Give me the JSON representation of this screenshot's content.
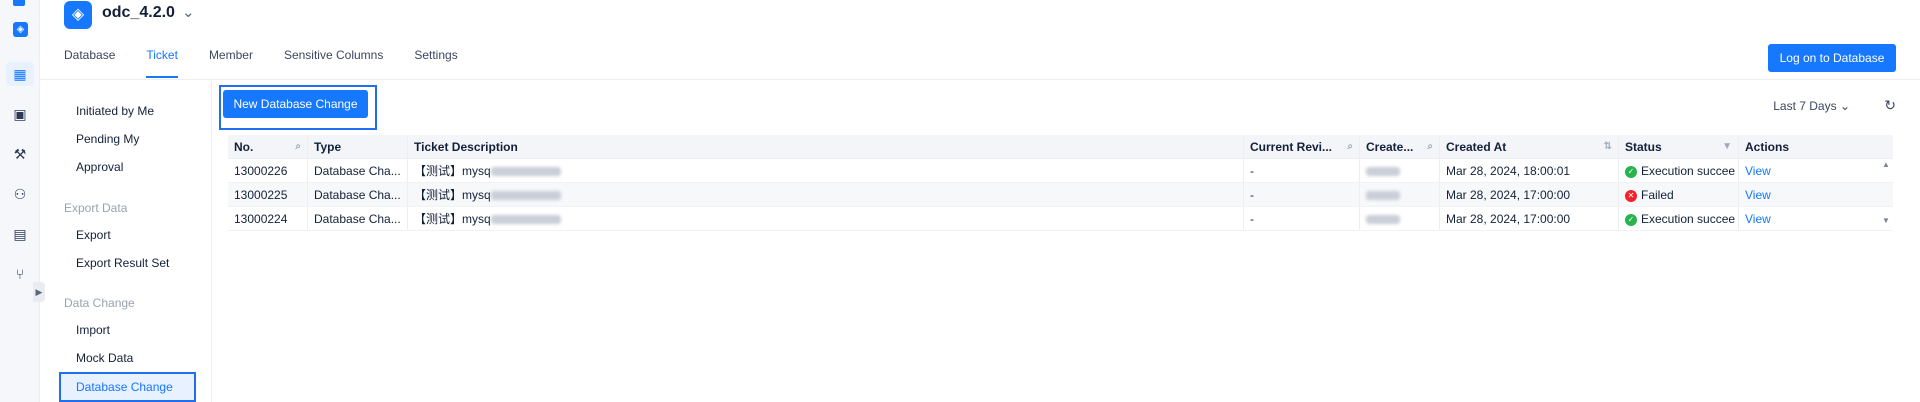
{
  "project": {
    "name": "odc_4.2.0"
  },
  "tabs": [
    {
      "label": "Database"
    },
    {
      "label": "Ticket"
    },
    {
      "label": "Member"
    },
    {
      "label": "Sensitive Columns"
    },
    {
      "label": "Settings"
    }
  ],
  "header": {
    "logon_label": "Log on to Database"
  },
  "sidebar": {
    "initiated": "Initiated by Me",
    "pending_1": "Pending My",
    "pending_2": "Approval",
    "export_group": "Export Data",
    "export": "Export",
    "export_result": "Export Result Set",
    "change_group": "Data Change",
    "import": "Import",
    "mock": "Mock Data",
    "db_change": "Database Change"
  },
  "toolbar": {
    "new_label": "New Database Change",
    "range_label": "Last 7 Days"
  },
  "table": {
    "headers": [
      "No.",
      "Type",
      "Ticket Description",
      "Current Revi...",
      "Create...",
      "Created At",
      "Status",
      "Actions"
    ],
    "rows": [
      {
        "no": "13000226",
        "type": "Database Cha...",
        "desc": "【测试】mysq",
        "reviewer": "-",
        "created_at": "Mar 28, 2024, 18:00:01",
        "status": "Execution succee",
        "status_kind": "ok",
        "action": "View"
      },
      {
        "no": "13000225",
        "type": "Database Cha...",
        "desc": "【测试】mysq",
        "reviewer": "-",
        "created_at": "Mar 28, 2024, 17:00:00",
        "status": "Failed",
        "status_kind": "fail",
        "action": "View"
      },
      {
        "no": "13000224",
        "type": "Database Cha...",
        "desc": "【测试】mysq",
        "reviewer": "-",
        "created_at": "Mar 28, 2024, 17:00:00",
        "status": "Execution succee",
        "status_kind": "ok",
        "action": "View"
      }
    ]
  },
  "icons": [
    "logo-icon",
    "database-icon",
    "ticket-icon",
    "briefcase-icon",
    "tool-icon",
    "user-icon",
    "report-icon",
    "branch-icon",
    "refresh-icon"
  ],
  "colors": {
    "accent": "#1677ff",
    "success": "#2bb24c",
    "error": "#f5222d"
  }
}
